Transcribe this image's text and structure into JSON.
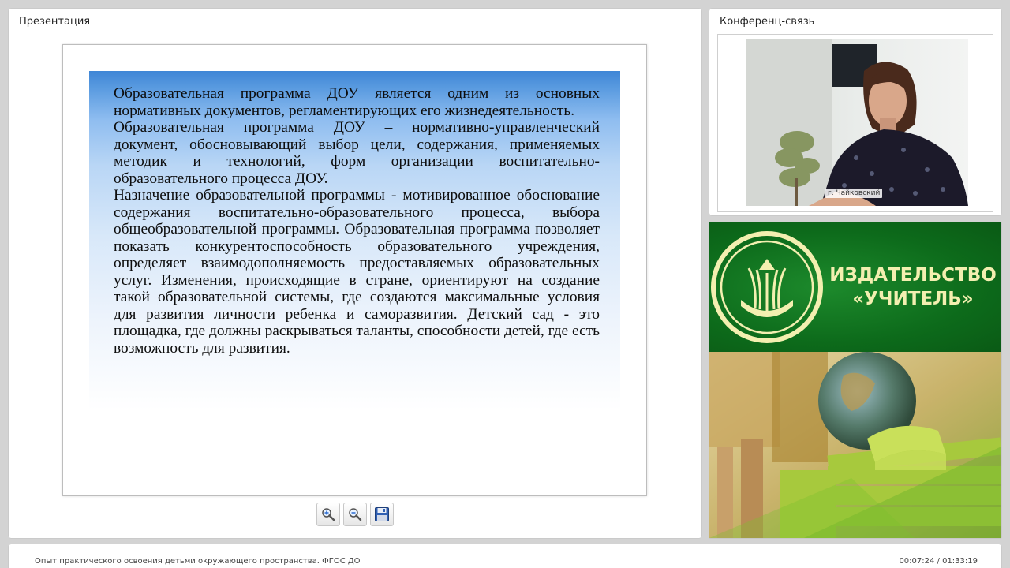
{
  "presentation": {
    "title": "Презентация",
    "slide": {
      "paragraphs": [
        "Образовательная программа ДОУ является одним из основных нормативных документов, регламентирующих его жизнедеятельность.",
        "Образовательная программа ДОУ – нормативно-управленческий документ, обосновывающий выбор цели, содержания, применяемых методик и технологий, форм организации воспитательно-образовательного процесса ДОУ.",
        "Назначение образовательной программы - мотивированное обоснование содержания воспитательно-образовательного процесса, выбора общеобразовательной программы. Образовательная программа позволяет показать конкурентоспособность образовательного учреждения, определяет взаимодополняемость предоставляемых образовательных услуг. Изменения, происходящие в стране, ориентируют на создание такой образовательной системы, где создаются максимальные условия для развития личности ребенка и саморазвития. Детский сад - это площадка, где должны раскрываться таланты, способности детей, где есть возможность для развития."
      ]
    },
    "toolbar": {
      "zoom_in_icon": "zoom-in-icon",
      "zoom_out_icon": "zoom-out-icon",
      "save_icon": "floppy-disk-icon"
    }
  },
  "conference": {
    "title": "Конференц-связь",
    "participant_location": "г. Чайковский"
  },
  "ad": {
    "publisher_name": "ИЗДАТЕЛЬСТВО «УЧИТЕЛЬ»",
    "brand_color": "#0d6b1b",
    "text_color": "#f3efb0"
  },
  "status_bar": {
    "course_title": "Опыт практического освоения детьми окружающего пространства. ФГОС ДО",
    "playback_time": "00:07:24 / 01:33:19"
  }
}
